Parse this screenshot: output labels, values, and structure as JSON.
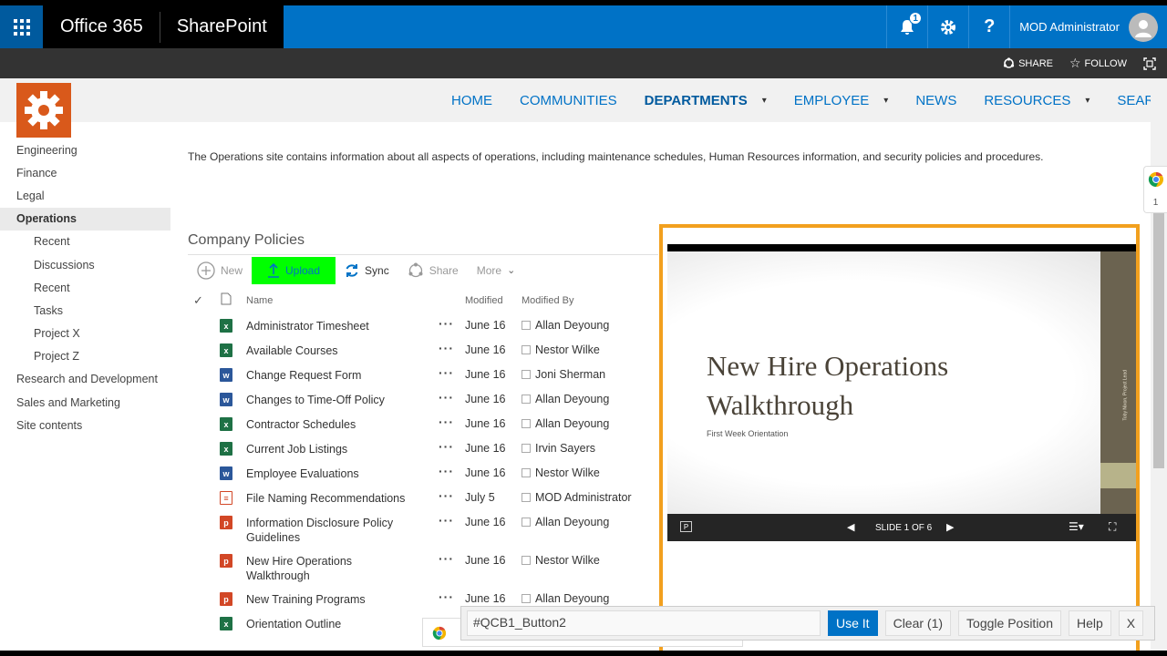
{
  "suite": {
    "brand": "Office 365",
    "app": "SharePoint",
    "notification_count": "1",
    "user_name": "MOD Administrator"
  },
  "ribbon": {
    "share": "SHARE",
    "follow": "FOLLOW"
  },
  "topnav": {
    "items": [
      {
        "label": "HOME"
      },
      {
        "label": "COMMUNITIES"
      },
      {
        "label": "DEPARTMENTS"
      },
      {
        "label": "EMPLOYEE"
      },
      {
        "label": "NEWS"
      },
      {
        "label": "RESOURCES"
      },
      {
        "label": "SEARCH"
      }
    ]
  },
  "leftnav": {
    "items": [
      {
        "label": "Engineering"
      },
      {
        "label": "Finance"
      },
      {
        "label": "Legal"
      },
      {
        "label": "Operations"
      },
      {
        "label": "Recent"
      },
      {
        "label": "Discussions"
      },
      {
        "label": "Recent"
      },
      {
        "label": "Tasks"
      },
      {
        "label": "Project X"
      },
      {
        "label": "Project Z"
      },
      {
        "label": "Research and Development"
      },
      {
        "label": "Sales and Marketing"
      },
      {
        "label": "Site contents"
      }
    ]
  },
  "description": "The Operations site contains information about all aspects of operations, including maintenance schedules, Human Resources information, and security policies and procedures.",
  "library": {
    "title": "Company Policies",
    "commands": {
      "new": "New",
      "upload": "Upload",
      "sync": "Sync",
      "share": "Share",
      "more": "More"
    },
    "columns": {
      "name": "Name",
      "modified": "Modified",
      "modified_by": "Modified By"
    },
    "files": [
      {
        "name": "Administrator Timesheet",
        "modified": "June 16",
        "by": "Allan Deyoung",
        "type": "x"
      },
      {
        "name": "Available Courses",
        "modified": "June 16",
        "by": "Nestor Wilke",
        "type": "x"
      },
      {
        "name": "Change Request Form",
        "modified": "June 16",
        "by": "Joni Sherman",
        "type": "w"
      },
      {
        "name": "Changes to Time-Off Policy",
        "modified": "June 16",
        "by": "Allan Deyoung",
        "type": "w"
      },
      {
        "name": "Contractor Schedules",
        "modified": "June 16",
        "by": "Allan Deyoung",
        "type": "x"
      },
      {
        "name": "Current Job Listings",
        "modified": "June 16",
        "by": "Irvin Sayers",
        "type": "x"
      },
      {
        "name": "Employee Evaluations",
        "modified": "June 16",
        "by": "Nestor Wilke",
        "type": "w"
      },
      {
        "name": "File Naming Recommendations",
        "modified": "July 5",
        "by": "MOD Administrator",
        "type": "t"
      },
      {
        "name": "Information Disclosure Policy Guidelines",
        "modified": "June 16",
        "by": "Allan Deyoung",
        "type": "p"
      },
      {
        "name": "New Hire Operations Walkthrough",
        "modified": "June 16",
        "by": "Nestor Wilke",
        "type": "p"
      },
      {
        "name": "New Training Programs",
        "modified": "June 16",
        "by": "Allan Deyoung",
        "type": "p"
      },
      {
        "name": "Orientation Outline",
        "modified": "",
        "by": "",
        "type": "x"
      }
    ]
  },
  "preview": {
    "slide_title": "New Hire Operations Walkthrough",
    "slide_subtitle": "First Week Orientation",
    "slide_side_text": "Toby Nixon, Project Lead",
    "slide_counter": "SLIDE 1 OF 6"
  },
  "qcb": {
    "input_value": "#QCB1_Button2",
    "use": "Use It",
    "clear": "Clear (1)",
    "toggle": "Toggle Position",
    "help": "Help",
    "close": "X"
  },
  "sidewidget": {
    "count": "1"
  },
  "colors": {
    "suite": "#0072c6",
    "upload_highlight": "#00ff00",
    "preview_border": "#f2a01e",
    "logo": "#d9591b"
  }
}
